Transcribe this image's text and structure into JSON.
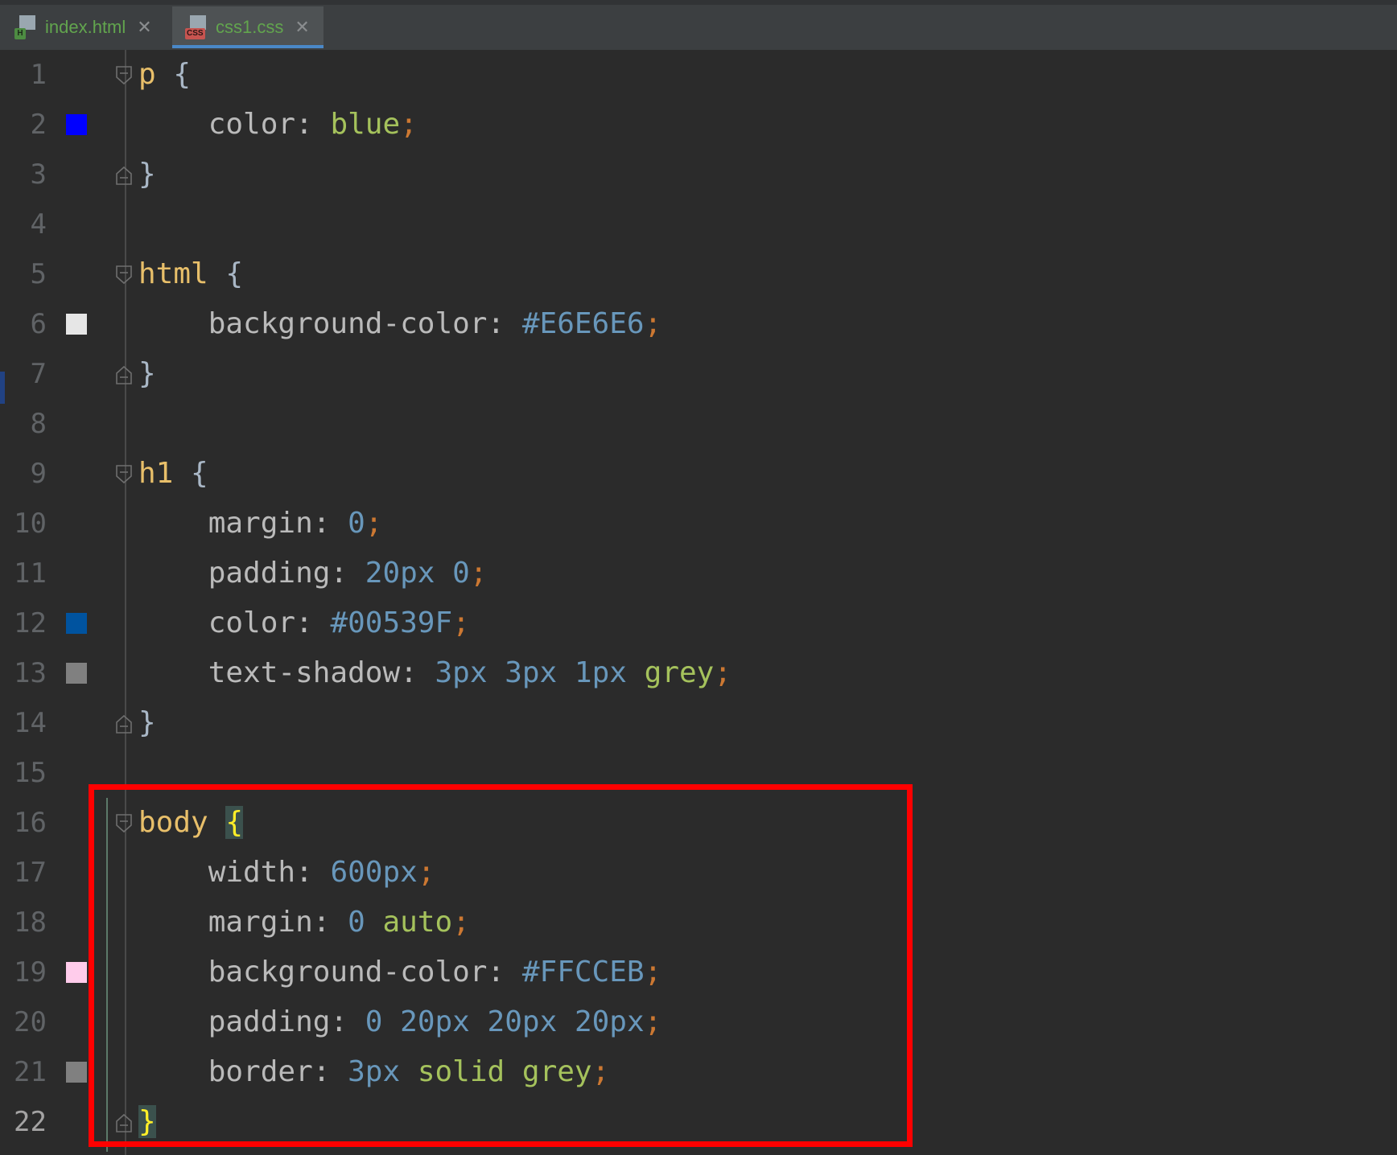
{
  "tabs": [
    {
      "label": "index.html",
      "badge": "H",
      "icon": "html-file-icon",
      "active": false
    },
    {
      "label": "css1.css",
      "badge": "CSS",
      "icon": "css-file-icon",
      "active": true
    }
  ],
  "lines": [
    {
      "num": "1",
      "sel": "p",
      "open": "{"
    },
    {
      "num": "2",
      "prop": "color",
      "vals": [
        {
          "t": "blue",
          "k": "kw"
        }
      ],
      "swatch": "#0000ff"
    },
    {
      "num": "3",
      "close": "}"
    },
    {
      "num": "4"
    },
    {
      "num": "5",
      "sel": "html",
      "open": "{"
    },
    {
      "num": "6",
      "prop": "background-color",
      "vals": [
        {
          "t": "#E6E6E6",
          "k": "num"
        }
      ],
      "swatch": "#e6e6e6"
    },
    {
      "num": "7",
      "close": "}"
    },
    {
      "num": "8"
    },
    {
      "num": "9",
      "sel": "h1",
      "open": "{"
    },
    {
      "num": "10",
      "prop": "margin",
      "vals": [
        {
          "t": "0",
          "k": "num"
        }
      ]
    },
    {
      "num": "11",
      "prop": "padding",
      "vals": [
        {
          "t": "20px",
          "k": "num"
        },
        {
          "t": "0",
          "k": "num"
        }
      ]
    },
    {
      "num": "12",
      "prop": "color",
      "vals": [
        {
          "t": "#00539F",
          "k": "num"
        }
      ],
      "swatch": "#00539f"
    },
    {
      "num": "13",
      "prop": "text-shadow",
      "vals": [
        {
          "t": "3px",
          "k": "num"
        },
        {
          "t": "3px",
          "k": "num"
        },
        {
          "t": "1px",
          "k": "num"
        },
        {
          "t": "grey",
          "k": "kw"
        }
      ],
      "swatch": "#808080"
    },
    {
      "num": "14",
      "close": "}"
    },
    {
      "num": "15"
    },
    {
      "num": "16",
      "sel": "body",
      "open": "{",
      "match": true
    },
    {
      "num": "17",
      "prop": "width",
      "vals": [
        {
          "t": "600px",
          "k": "num"
        }
      ]
    },
    {
      "num": "18",
      "prop": "margin",
      "vals": [
        {
          "t": "0",
          "k": "num"
        },
        {
          "t": "auto",
          "k": "kw"
        }
      ]
    },
    {
      "num": "19",
      "prop": "background-color",
      "vals": [
        {
          "t": "#FFCCEB",
          "k": "num"
        }
      ],
      "swatch": "#ffcceb"
    },
    {
      "num": "20",
      "prop": "padding",
      "vals": [
        {
          "t": "0",
          "k": "num"
        },
        {
          "t": "20px",
          "k": "num"
        },
        {
          "t": "20px",
          "k": "num"
        },
        {
          "t": "20px",
          "k": "num"
        }
      ]
    },
    {
      "num": "21",
      "prop": "border",
      "vals": [
        {
          "t": "3px",
          "k": "num"
        },
        {
          "t": "solid",
          "k": "kw"
        },
        {
          "t": "grey",
          "k": "kw"
        }
      ],
      "swatch": "#808080"
    },
    {
      "num": "22",
      "close": "}",
      "match": true,
      "current": true
    }
  ],
  "colors": {
    "selector": "#e8bf6a",
    "number": "#6897bb",
    "keyword": "#a5c25c",
    "semicolon": "#cc7832",
    "highlight_box": "#ff0000"
  }
}
